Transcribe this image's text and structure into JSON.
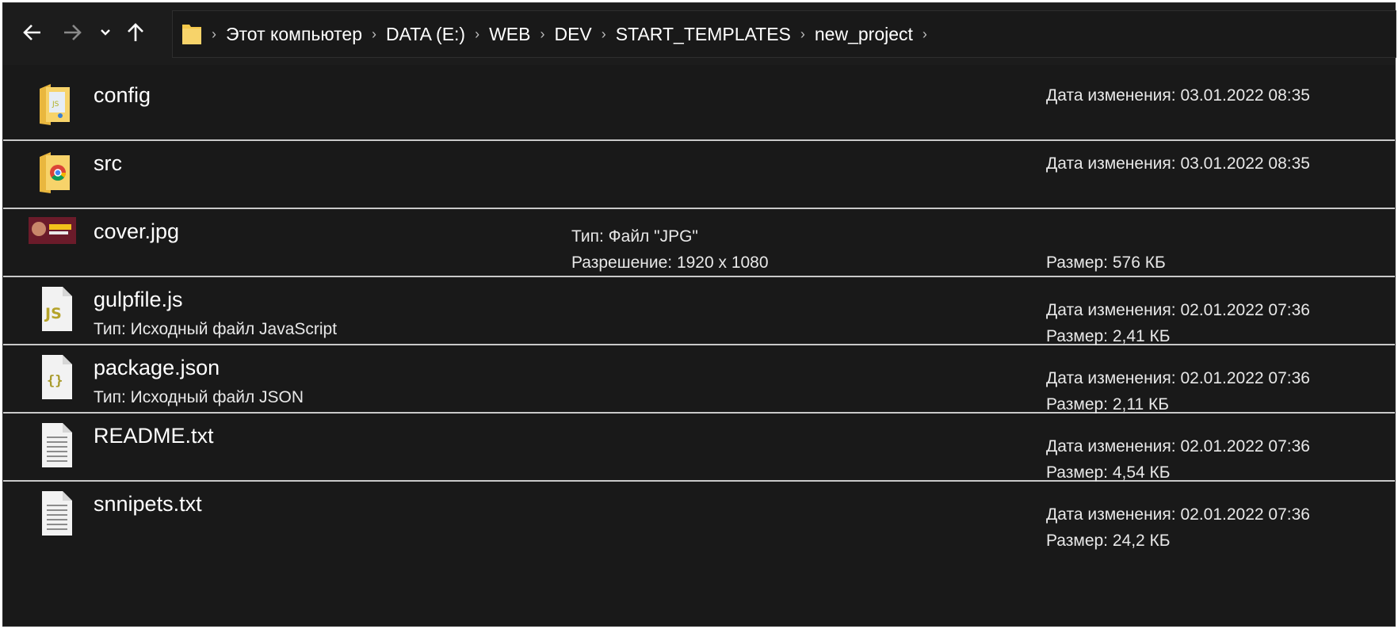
{
  "breadcrumbs": [
    "Этот компьютер",
    "DATA (E:)",
    "WEB",
    "DEV",
    "START_TEMPLATES",
    "new_project"
  ],
  "colors": {
    "background": "#191919",
    "text": "#ffffff",
    "divider": "#c9c9c9",
    "folder": "#f4c84a"
  },
  "files": [
    {
      "name": "config",
      "icon": "folder-js-icon",
      "right1": "Дата изменения: 03.01.2022 08:35"
    },
    {
      "name": "src",
      "icon": "folder-chrome-icon",
      "right1": "Дата изменения: 03.01.2022 08:35"
    },
    {
      "name": "cover.jpg",
      "icon": "image-thumbnail-icon",
      "mid1": "Тип: Файл \"JPG\"",
      "mid2": "Разрешение: 1920 x 1080",
      "right_only": "Размер: 576 КБ"
    },
    {
      "name": "gulpfile.js",
      "icon": "js-file-icon",
      "sub": "Тип: Исходный файл JavaScript",
      "right1": "Дата изменения: 02.01.2022 07:36",
      "right2": "Размер: 2,41 КБ"
    },
    {
      "name": "package.json",
      "icon": "json-file-icon",
      "sub": "Тип: Исходный файл JSON",
      "right1": "Дата изменения: 02.01.2022 07:36",
      "right2": "Размер: 2,11 КБ"
    },
    {
      "name": "README.txt",
      "icon": "text-file-icon",
      "right1": "Дата изменения: 02.01.2022 07:36",
      "right2": "Размер: 4,54 КБ"
    },
    {
      "name": "snnipets.txt",
      "icon": "text-file-icon",
      "right1": "Дата изменения: 02.01.2022 07:36",
      "right2": "Размер: 24,2 КБ"
    }
  ]
}
